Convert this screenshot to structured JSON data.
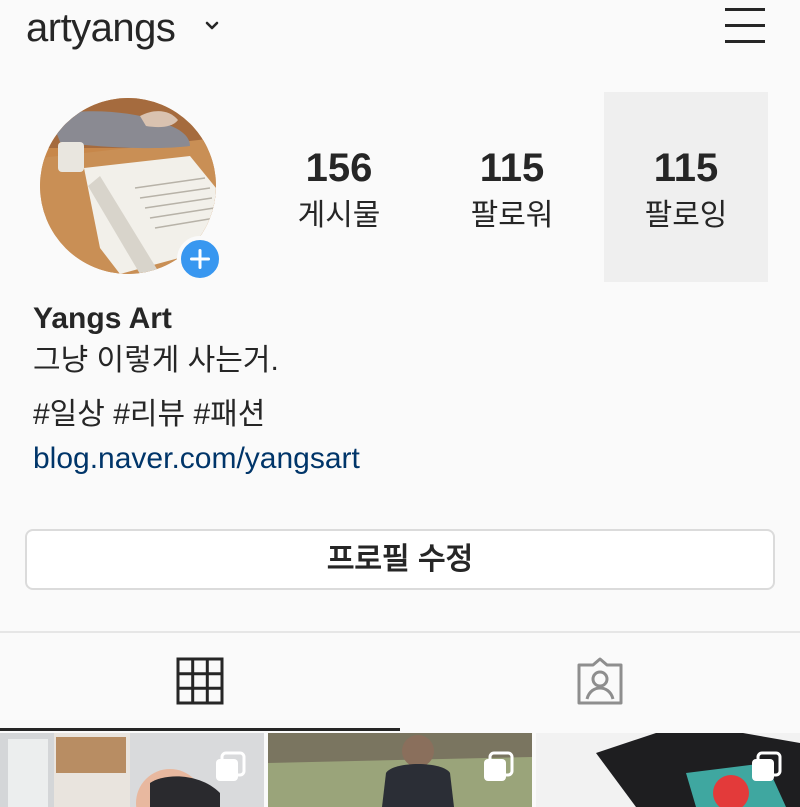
{
  "header": {
    "username": "artyangs",
    "dropdown_icon": "chevron-down-icon",
    "menu_icon": "hamburger-menu-icon"
  },
  "profile": {
    "avatar_icon": "profile-photo",
    "add_story_icon": "plus-icon",
    "stats": {
      "posts": {
        "count": "156",
        "label": "게시물"
      },
      "followers": {
        "count": "115",
        "label": "팔로워"
      },
      "following": {
        "count": "115",
        "label": "팔로잉"
      }
    },
    "name": "Yangs Art",
    "bio": "그냥 이렇게 사는거.",
    "hashtags": "#일상 #리뷰 #패션",
    "website": "blog.naver.com/yangsart"
  },
  "actions": {
    "edit_profile_label": "프로필 수정"
  },
  "tabs": [
    {
      "icon": "grid-icon",
      "active": true
    },
    {
      "icon": "tagged-person-icon",
      "active": false
    }
  ],
  "colors": {
    "accent_blue": "#3897f0",
    "link_color": "#003569",
    "background": "#fafafa",
    "highlight": "#efefef"
  }
}
